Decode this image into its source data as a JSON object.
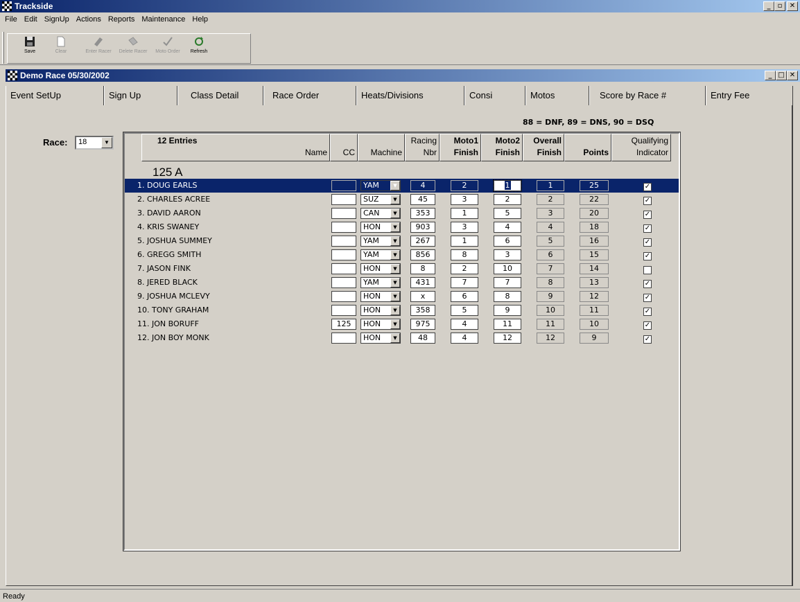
{
  "app": {
    "title": "Trackside"
  },
  "menu": [
    "File",
    "Edit",
    "SignUp",
    "Actions",
    "Reports",
    "Maintenance",
    "Help"
  ],
  "toolbar": {
    "save": "Save",
    "clear": "Clear",
    "enter_racer": "Enter Racer",
    "delete_racer": "Delete Racer",
    "moto_order": "Moto Order",
    "refresh": "Refresh"
  },
  "document": {
    "title": "Demo Race 05/30/2002"
  },
  "tabs": [
    "Event SetUp",
    "Sign Up",
    "Class Detail",
    "Race Order",
    "Heats/Divisions",
    "Consi",
    "Motos",
    "Score by Race #",
    "Entry Fee"
  ],
  "active_tab": "Score by Race #",
  "legend": "88 = DNF, 89 = DNS, 90 = DSQ",
  "race": {
    "label": "Race:",
    "value": "18"
  },
  "grid": {
    "entries": "12 Entries",
    "headers": {
      "name": "Name",
      "cc": "CC",
      "machine": "Machine",
      "racing_1": "Racing",
      "racing_2": "Nbr",
      "moto1_1": "Moto1",
      "moto1_2": "Finish",
      "moto2_1": "Moto2",
      "moto2_2": "Finish",
      "overall_1": "Overall",
      "overall_2": "Finish",
      "points": "Points",
      "qual_1": "Qualifying",
      "qual_2": "Indicator"
    },
    "class_name": "125 A",
    "rows": [
      {
        "name": "1. DOUG  EARLS",
        "cc": "",
        "machine": "YAM",
        "nbr": "4",
        "moto1": "2",
        "moto2": "1",
        "overall": "1",
        "points": "25",
        "qual": "✓"
      },
      {
        "name": "2. CHARLES  ACREE",
        "cc": "",
        "machine": "SUZ",
        "nbr": "45",
        "moto1": "3",
        "moto2": "2",
        "overall": "2",
        "points": "22",
        "qual": "✓"
      },
      {
        "name": "3. DAVID  AARON",
        "cc": "",
        "machine": "CAN",
        "nbr": "353",
        "moto1": "1",
        "moto2": "5",
        "overall": "3",
        "points": "20",
        "qual": "✓"
      },
      {
        "name": "4. KRIS  SWANEY",
        "cc": "",
        "machine": "HON",
        "nbr": "903",
        "moto1": "3",
        "moto2": "4",
        "overall": "4",
        "points": "18",
        "qual": "✓"
      },
      {
        "name": "5. JOSHUA  SUMMEY",
        "cc": "",
        "machine": "YAM",
        "nbr": "267",
        "moto1": "1",
        "moto2": "6",
        "overall": "5",
        "points": "16",
        "qual": "✓"
      },
      {
        "name": "6. GREGG  SMITH",
        "cc": "",
        "machine": "YAM",
        "nbr": "856",
        "moto1": "8",
        "moto2": "3",
        "overall": "6",
        "points": "15",
        "qual": "✓"
      },
      {
        "name": "7. JASON  FINK",
        "cc": "",
        "machine": "HON",
        "nbr": "8",
        "moto1": "2",
        "moto2": "10",
        "overall": "7",
        "points": "14",
        "qual": ""
      },
      {
        "name": "8. JERED  BLACK",
        "cc": "",
        "machine": "YAM",
        "nbr": "431",
        "moto1": "7",
        "moto2": "7",
        "overall": "8",
        "points": "13",
        "qual": "✓"
      },
      {
        "name": "9. JOSHUA  MCLEVY",
        "cc": "",
        "machine": "HON",
        "nbr": "x",
        "moto1": "6",
        "moto2": "8",
        "overall": "9",
        "points": "12",
        "qual": "✓"
      },
      {
        "name": "10. TONY  GRAHAM",
        "cc": "",
        "machine": "HON",
        "nbr": "358",
        "moto1": "5",
        "moto2": "9",
        "overall": "10",
        "points": "11",
        "qual": "✓"
      },
      {
        "name": "11. JON  BORUFF",
        "cc": "125",
        "machine": "HON",
        "nbr": "975",
        "moto1": "4",
        "moto2": "11",
        "overall": "11",
        "points": "10",
        "qual": "✓"
      },
      {
        "name": "12. JON BOY  MONK",
        "cc": "",
        "machine": "HON",
        "nbr": "48",
        "moto1": "4",
        "moto2": "12",
        "overall": "12",
        "points": "9",
        "qual": "✓"
      }
    ]
  },
  "status": "Ready",
  "colors": {
    "title_bar": "#0a246a",
    "face": "#d4d0c8",
    "selection": "#0a246a"
  }
}
